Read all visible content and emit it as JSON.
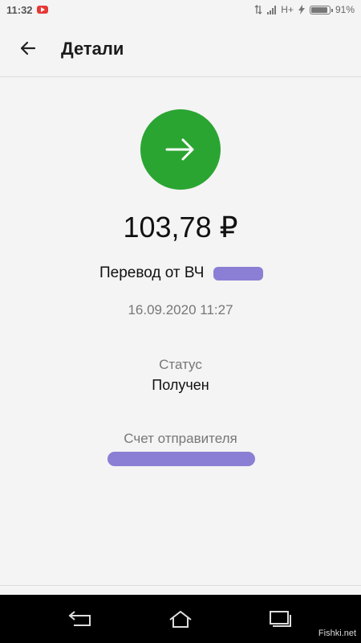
{
  "status_bar": {
    "time": "11:32",
    "network": "H+",
    "battery": "91%"
  },
  "header": {
    "title": "Детали"
  },
  "transaction": {
    "icon": "arrow-right-icon",
    "icon_color": "#2aa532",
    "amount": "103,78 ₽",
    "description": "Перевод от ВЧ",
    "datetime": "16.09.2020 11:27",
    "status_label": "Статус",
    "status_value": "Получен",
    "sender_account_label": "Счет отправителя"
  },
  "watermark": "Fishki.net"
}
